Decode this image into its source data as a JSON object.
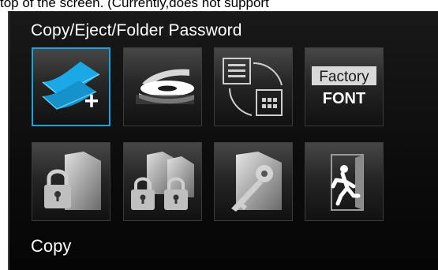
{
  "doc_text": "top of the screen. (Currently,does not support",
  "dialog": {
    "title": "Copy/Eject/Folder Password",
    "status": "Copy"
  },
  "tiles": [
    {
      "name": "copy",
      "icon": "copy-stack-icon",
      "selected": true
    },
    {
      "name": "eject",
      "icon": "eject-disc-icon",
      "selected": false
    },
    {
      "name": "folder-view",
      "icon": "folder-grid-icon",
      "selected": false
    },
    {
      "name": "factory-font",
      "icon": "factory-font-icon",
      "label_top": "Factory",
      "label_bottom": "FONT",
      "selected": false
    },
    {
      "name": "lock-folder",
      "icon": "locked-folder-icon",
      "selected": false
    },
    {
      "name": "lock-all-folders",
      "icon": "locked-folders-icon",
      "selected": false
    },
    {
      "name": "unlock-folder",
      "icon": "folder-key-icon",
      "selected": false
    },
    {
      "name": "exit",
      "icon": "exit-door-icon",
      "selected": false
    }
  ],
  "colors": {
    "selection_border": "#1aa3e0",
    "copy_icon": "#1ba8e6",
    "background": "#0d0d0d"
  }
}
